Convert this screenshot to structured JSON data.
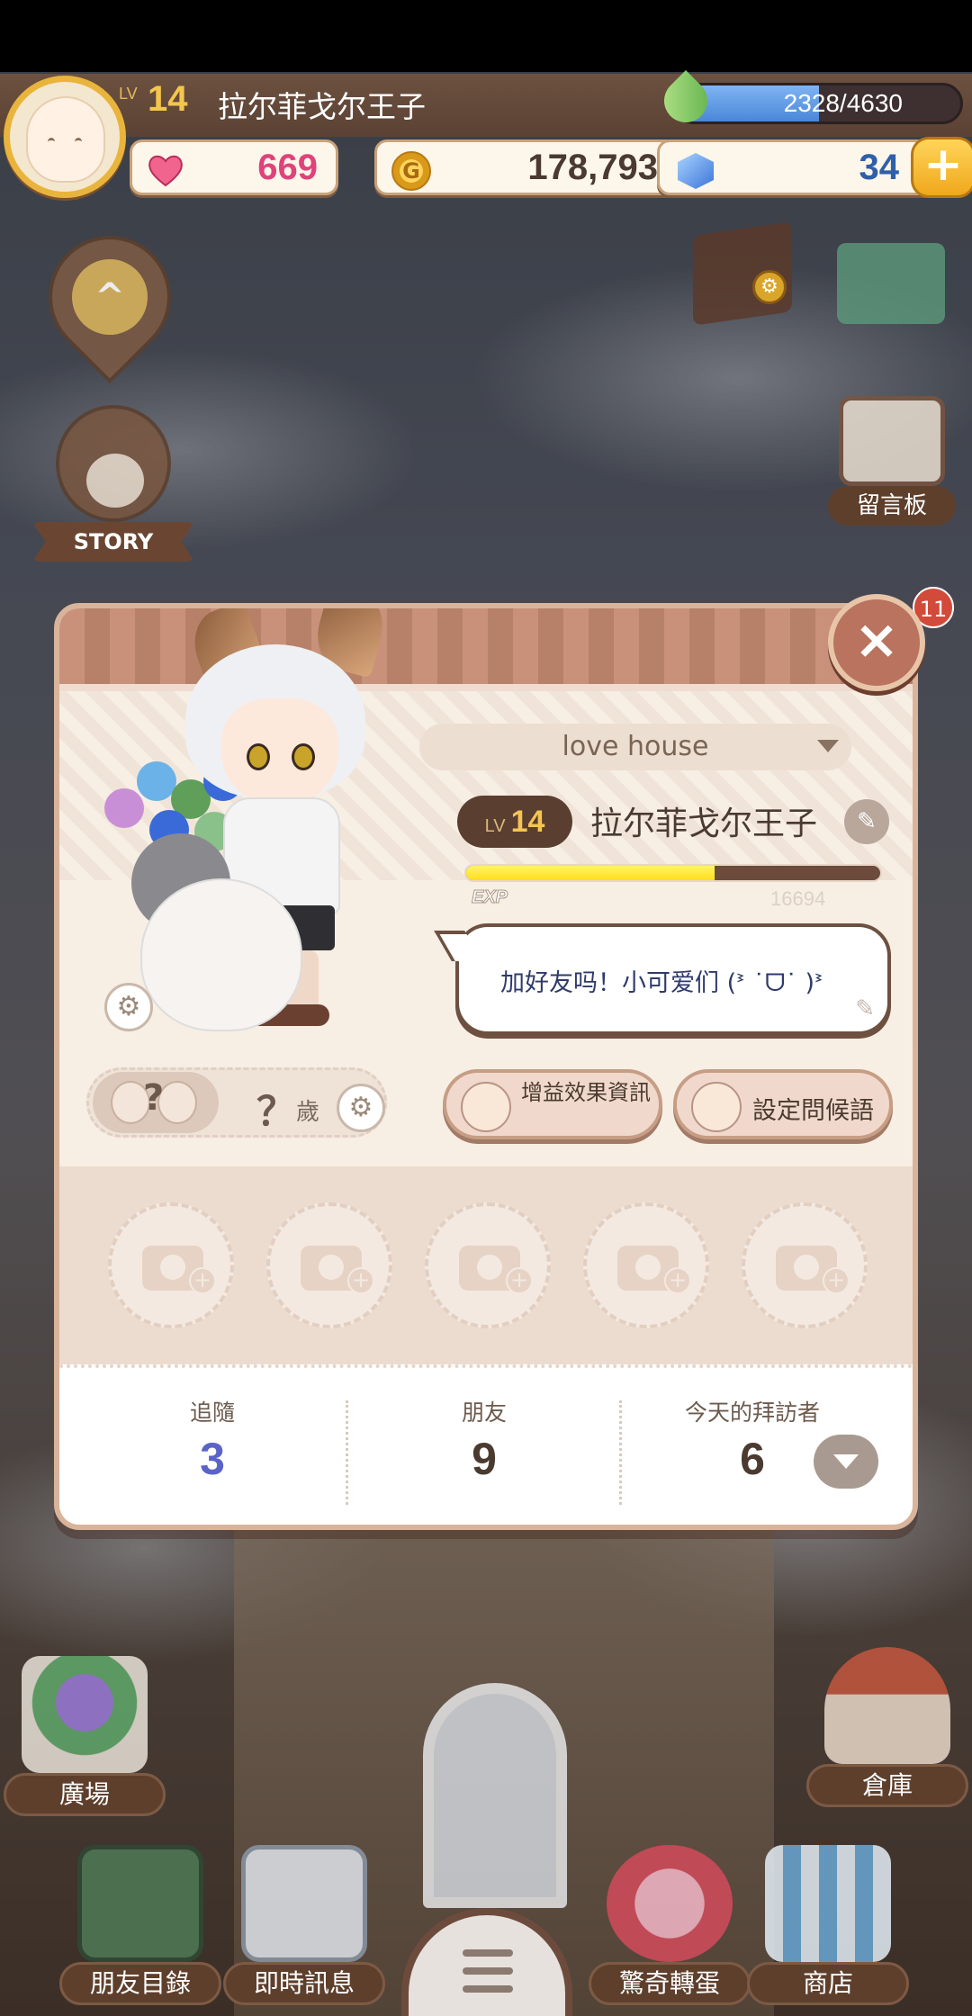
{
  "hud": {
    "level_prefix": "LV",
    "level": "14",
    "player_name": "拉尔菲戈尔王子",
    "stamina_text": "2328/4630",
    "stamina_fraction": 0.503,
    "hearts": "669",
    "coins": "178,793",
    "gems": "34",
    "coin_symbol": "G",
    "plus": "+"
  },
  "side": {
    "story_label": "STORY",
    "board_label": "留言板",
    "notification_count": "11",
    "up_arrow": "^"
  },
  "card": {
    "close": "×",
    "house_name": "love house",
    "level_prefix": "LV",
    "level": "14",
    "name": "拉尔菲戈尔王子",
    "exp_label": "EXP",
    "exp_fraction": 0.6,
    "exp_value": "16694",
    "greeting": "加好友吗！小可爱们 (ᕑ ˙ᗜ˙ )ᕑ",
    "age_value": "？",
    "age_unit": "歲",
    "relation_unknown": "?",
    "buff_button": "增益效果資訊",
    "greeting_button": "設定問候語",
    "photo_slots": 5,
    "stats": [
      {
        "label": "追隨",
        "value": "3",
        "color": "#5a63c8"
      },
      {
        "label": "朋友",
        "value": "9",
        "color": "#4a3a30"
      },
      {
        "label": "今天的拜訪者",
        "value": "6",
        "color": "#4a3a30"
      }
    ]
  },
  "nav": {
    "plaza": "廣場",
    "warehouse": "倉庫",
    "friends_list": "朋友目錄",
    "instant_message": "即時訊息",
    "gacha": "驚奇轉蛋",
    "shop": "商店"
  },
  "colors": {
    "heart": "#e0427a",
    "coin_text": "#4a3a30",
    "gem_text": "#2f5fa8",
    "level_gold": "#f3c64e"
  }
}
